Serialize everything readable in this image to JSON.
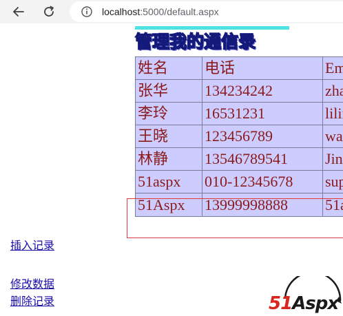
{
  "browser": {
    "url_host": "localhost",
    "url_path": ":5000/default.aspx"
  },
  "page": {
    "title": "管理我的通信录",
    "table": {
      "headers": [
        "姓名",
        "电话",
        "Em"
      ],
      "rows": [
        [
          "张华",
          "134234242",
          "zha"
        ],
        [
          "李玲",
          "16531231",
          "lilin"
        ],
        [
          "王晓",
          "123456789",
          "wa"
        ],
        [
          "林静",
          "13546789541",
          "Jing"
        ],
        [
          "51aspx",
          "010-12345678",
          "sup"
        ],
        [
          "51Aspx",
          "13999998888",
          "51a"
        ]
      ]
    },
    "links": {
      "insert": "插入记录",
      "edit": "修改数据",
      "delete": "删除记录"
    },
    "logo": {
      "part1": "51",
      "part2": "Aspx"
    }
  },
  "colors": {
    "table_bg": "#ccccff",
    "cell_text": "#8b1a1a",
    "banner_accent": "#4ee1e1",
    "selection_border": "#e23a3a",
    "link": "#1a0dab"
  }
}
